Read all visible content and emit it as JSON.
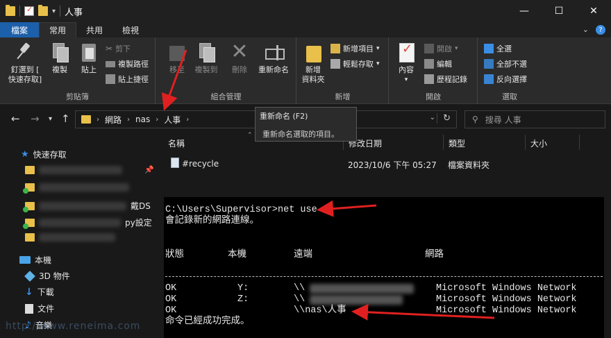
{
  "window": {
    "title": "人事",
    "controls": [
      "minimize",
      "maximize",
      "close"
    ]
  },
  "ribbon_tabs": [
    {
      "label": "檔案"
    },
    {
      "label": "常用"
    },
    {
      "label": "共用"
    },
    {
      "label": "檢視"
    }
  ],
  "ribbon": {
    "clipboard": {
      "label": "剪貼簿",
      "pin": "釘選到 [\n快速存取]",
      "copy": "複製",
      "paste": "貼上",
      "cut": "剪下",
      "copy_path": "複製路徑",
      "paste_shortcut": "貼上捷徑"
    },
    "organize": {
      "label": "組合管理",
      "move_to": "移至",
      "copy_to": "複製到",
      "delete": "刪除",
      "rename": "重新命名"
    },
    "new": {
      "label": "新增",
      "new_folder": "新增\n資料夾",
      "new_item": "新增項目",
      "easy_access": "輕鬆存取"
    },
    "open": {
      "label": "開啟",
      "properties": "內容",
      "open": "開啟",
      "edit": "編輯",
      "history": "歷程記錄"
    },
    "select": {
      "label": "選取",
      "select_all": "全選",
      "select_none": "全部不選",
      "invert": "反向選擇"
    }
  },
  "address": {
    "crumbs": [
      "網路",
      "nas",
      "人事"
    ],
    "search_placeholder": "搜尋 人事"
  },
  "tooltip": {
    "title": "重新命名 (F2)",
    "desc": "重新命名選取的項目。"
  },
  "nav_pane": {
    "quick_access": "快速存取",
    "partial_1": "戴DS",
    "partial_2": "py設定",
    "this_pc": "本機",
    "objects_3d": "3D 物件",
    "downloads": "下載",
    "documents": "文件",
    "music": "音樂"
  },
  "columns": {
    "name": "名稱",
    "modified": "修改日期",
    "type": "類型",
    "size": "大小"
  },
  "files": [
    {
      "name": "#recycle",
      "modified": "2023/10/6 下午 05:27",
      "type": "檔案資料夾"
    }
  ],
  "cmd": {
    "prompt": "C:\\Users\\Supervisor>net use",
    "line2": "會記錄新的網路連線。",
    "hdr_status": "狀態",
    "hdr_local": "本機",
    "hdr_remote": "遠端",
    "hdr_network": "網路",
    "rows": [
      {
        "status": "OK",
        "local": "Y:",
        "remote": "\\\\",
        "network": "Microsoft Windows Network"
      },
      {
        "status": "OK",
        "local": "Z:",
        "remote": "\\\\",
        "network": "Microsoft Windows Network"
      },
      {
        "status": "OK",
        "local": "",
        "remote": "\\\\nas\\人事",
        "network": "Microsoft Windows Network"
      }
    ],
    "done": "命令已經成功完成。"
  },
  "watermark": "http://www.reneima.com",
  "colors": {
    "accent": "#1c5faa",
    "arrow": "#e02020",
    "folder": "#e8c04a"
  }
}
